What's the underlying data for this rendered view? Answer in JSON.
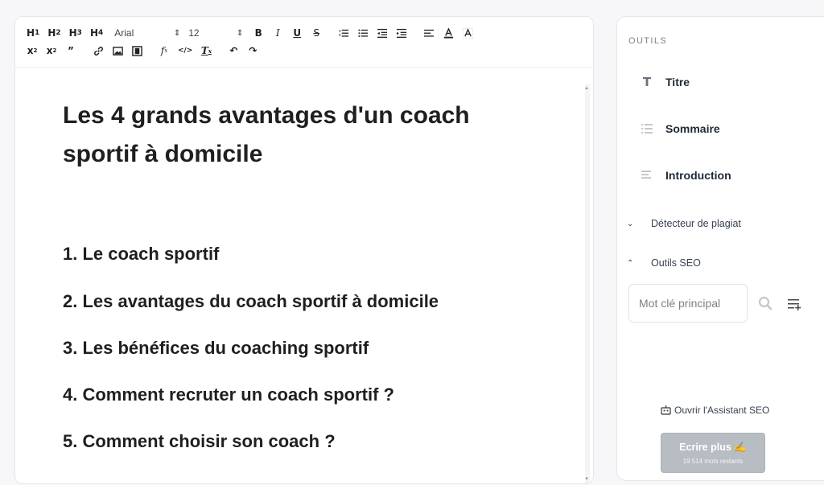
{
  "toolbar": {
    "headings": [
      "H1",
      "H2",
      "H3",
      "H4"
    ],
    "font_family": "Arial",
    "font_size": "12",
    "format_buttons": [
      "bold-icon",
      "italic-icon",
      "underline-icon",
      "strikethrough-icon",
      "ordered-list-icon",
      "unordered-list-icon",
      "outdent-icon",
      "indent-icon",
      "align-left-icon",
      "text-color-icon",
      "highlight-icon"
    ],
    "row2_buttons": [
      "superscript-icon",
      "subscript-icon",
      "quote-icon",
      "link-icon",
      "image-icon",
      "video-icon",
      "formula-icon",
      "code-icon",
      "clear-format-icon",
      "undo-icon",
      "redo-icon"
    ]
  },
  "document": {
    "title": "Les 4 grands avantages d'un coach sportif à domicile",
    "toc": [
      "1. Le coach sportif",
      "2. Les avantages du coach sportif à domicile",
      "3. Les bénéfices du coaching sportif",
      "4. Comment recruter un coach sportif ?",
      "5. Comment choisir son coach ?"
    ]
  },
  "sidebar": {
    "heading": "OUTILS",
    "tools": [
      {
        "label": "Titre",
        "icon": "title-icon"
      },
      {
        "label": "Sommaire",
        "icon": "list-icon"
      },
      {
        "label": "Introduction",
        "icon": "paragraph-icon"
      }
    ],
    "plagiarism": "Détecteur de plagiat",
    "seo_tools": "Outils SEO",
    "keyword_placeholder": "Mot clé principal",
    "assistant_link": "Ouvrir l'Assistant SEO",
    "write_more": "Ecrire plus ✍️",
    "words_remaining": "19 514 mots restants"
  },
  "colors": {
    "button_disabled": "#b8bcc3",
    "text_dark": "#1f1f1f"
  }
}
